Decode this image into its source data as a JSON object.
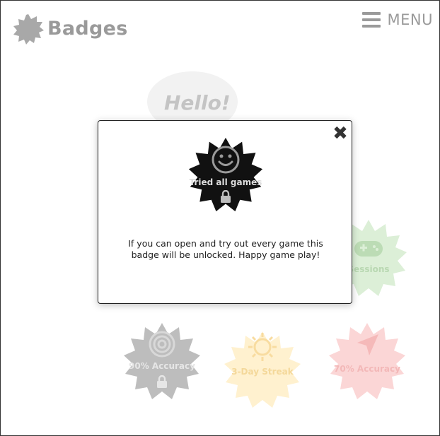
{
  "header": {
    "title": "Badges",
    "menu_label": "MENU",
    "logo_icon": "badge-gear-icon",
    "menu_icon": "hamburger-icon"
  },
  "background": {
    "hello_text": "Hello!",
    "badges": [
      {
        "label": "Sessions",
        "icon": "gamepad-icon",
        "color": "#cde9c8"
      },
      {
        "label": "90% Accuracy",
        "icon": "target-icon",
        "color": "#b8b8b8",
        "locked": true
      },
      {
        "label": "3-Day Streak",
        "icon": "sun-icon",
        "color": "#fdebc0"
      },
      {
        "label": "70% Accuracy",
        "icon": "arrow-cursor-icon",
        "color": "#f8c9c9"
      }
    ]
  },
  "modal": {
    "badge_label": "Tried all games",
    "badge_icon": "smiley-icon",
    "lock_icon": "lock-icon",
    "close_icon": "close-x-icon",
    "close_glyph": "✖",
    "description": "If you can open and try out every game this badge will be unlocked. Happy game play!",
    "badge_color": "#111111"
  }
}
